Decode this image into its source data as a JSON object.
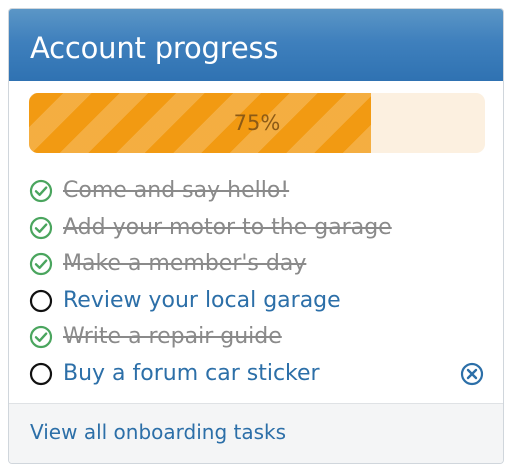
{
  "widget": {
    "title": "Account progress",
    "progress": {
      "percent": 75,
      "label": "75%",
      "fill_color": "#f29a12",
      "track_color": "#fcf0e0"
    },
    "tasks": [
      {
        "label": "Come and say hello!",
        "done": true
      },
      {
        "label": "Add your motor to the garage",
        "done": true
      },
      {
        "label": "Make a member's day",
        "done": true
      },
      {
        "label": "Review your local garage",
        "done": false
      },
      {
        "label": "Write a repair guide",
        "done": true
      },
      {
        "label": "Buy a forum car sticker",
        "done": false
      }
    ],
    "icons": {
      "done": "check-circle-icon",
      "open": "empty-circle-icon",
      "dismiss": "close-circle-icon"
    },
    "colors": {
      "header": "#3f80bd",
      "check": "#4aa55e",
      "link": "#2c6fa8",
      "done_text": "#8a8a8a"
    },
    "footer_link": "View all onboarding tasks"
  }
}
